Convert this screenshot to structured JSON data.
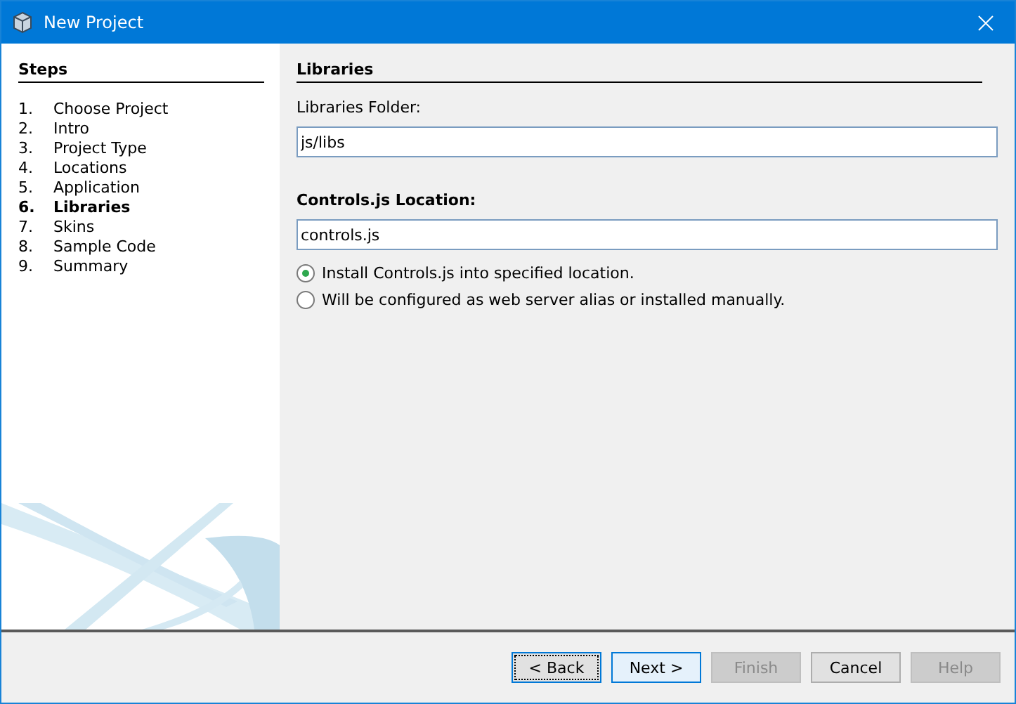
{
  "window": {
    "title": "New Project"
  },
  "steps": {
    "title": "Steps",
    "items": [
      {
        "number": "1.",
        "label": "Choose Project",
        "selected": false
      },
      {
        "number": "2.",
        "label": "Intro",
        "selected": false
      },
      {
        "number": "3.",
        "label": "Project Type",
        "selected": false
      },
      {
        "number": "4.",
        "label": "Locations",
        "selected": false
      },
      {
        "number": "5.",
        "label": "Application",
        "selected": false
      },
      {
        "number": "6.",
        "label": "Libraries",
        "selected": true
      },
      {
        "number": "7.",
        "label": "Skins",
        "selected": false
      },
      {
        "number": "8.",
        "label": "Sample Code",
        "selected": false
      },
      {
        "number": "9.",
        "label": "Summary",
        "selected": false
      }
    ]
  },
  "panel": {
    "title": "Libraries",
    "fields": [
      {
        "label": "Libraries Folder:",
        "value": "js/libs",
        "bold": false
      },
      {
        "label": "Controls.js Location:",
        "value": "controls.js",
        "bold": true
      }
    ],
    "options": [
      {
        "label": "Install Controls.js into specified location.",
        "selected": true
      },
      {
        "label": "Will be configured as web server alias or installed manually.",
        "selected": false
      }
    ]
  },
  "buttons": [
    {
      "label": "< Back",
      "disabled": false,
      "focused": true,
      "hovered": false
    },
    {
      "label": "Next >",
      "disabled": false,
      "focused": false,
      "hovered": true
    },
    {
      "label": "Finish",
      "disabled": true,
      "focused": false,
      "hovered": false
    },
    {
      "label": "Cancel",
      "disabled": false,
      "focused": false,
      "hovered": false
    },
    {
      "label": "Help",
      "disabled": true,
      "focused": false,
      "hovered": false
    }
  ]
}
